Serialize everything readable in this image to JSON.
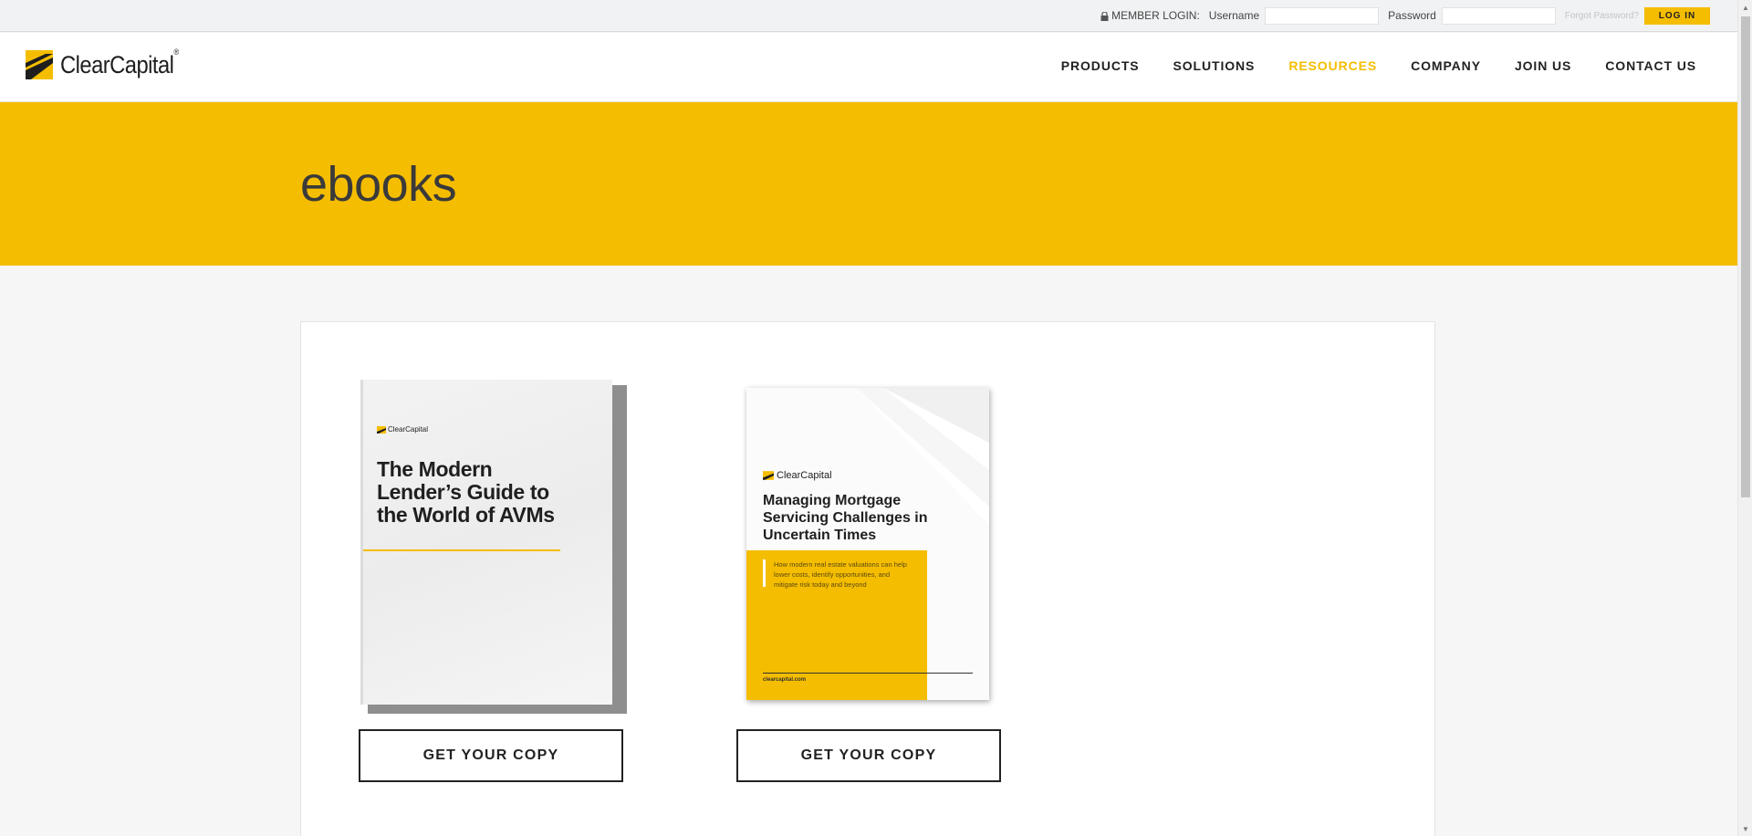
{
  "topbar": {
    "member_login_label": "MEMBER LOGIN:",
    "username_label": "Username",
    "username_value": "",
    "password_label": "Password",
    "password_value": "",
    "forgot_password": "Forgot Password?",
    "login_button": "LOG IN"
  },
  "header": {
    "logo_text": "ClearCapital",
    "logo_mark": "®",
    "nav": [
      {
        "label": "PRODUCTS"
      },
      {
        "label": "SOLUTIONS"
      },
      {
        "label": "RESOURCES",
        "active": true
      },
      {
        "label": "COMPANY"
      },
      {
        "label": "JOIN US"
      },
      {
        "label": "CONTACT US"
      }
    ]
  },
  "hero": {
    "title": "ebooks"
  },
  "ebooks": [
    {
      "cover_brand": "ClearCapital",
      "title": "The Modern Lender’s Guide to the World of AVMs",
      "button": "GET YOUR COPY"
    },
    {
      "cover_brand": "ClearCapital",
      "title": "Managing Mortgage Servicing Challenges in Uncertain Times",
      "description": "How modern real estate valuations can help lower costs, identify opportunities, and mitigate risk today and beyond",
      "site": "clearcapital.com",
      "button": "GET YOUR COPY"
    }
  ],
  "colors": {
    "accent": "#f5bd00",
    "text_dark": "#222222",
    "hero_title": "#3a3a3a",
    "page_bg": "#f6f6f6"
  },
  "icons": [
    "lock-icon",
    "clearcapital-logo-icon",
    "scroll-up-icon",
    "scroll-down-icon"
  ]
}
